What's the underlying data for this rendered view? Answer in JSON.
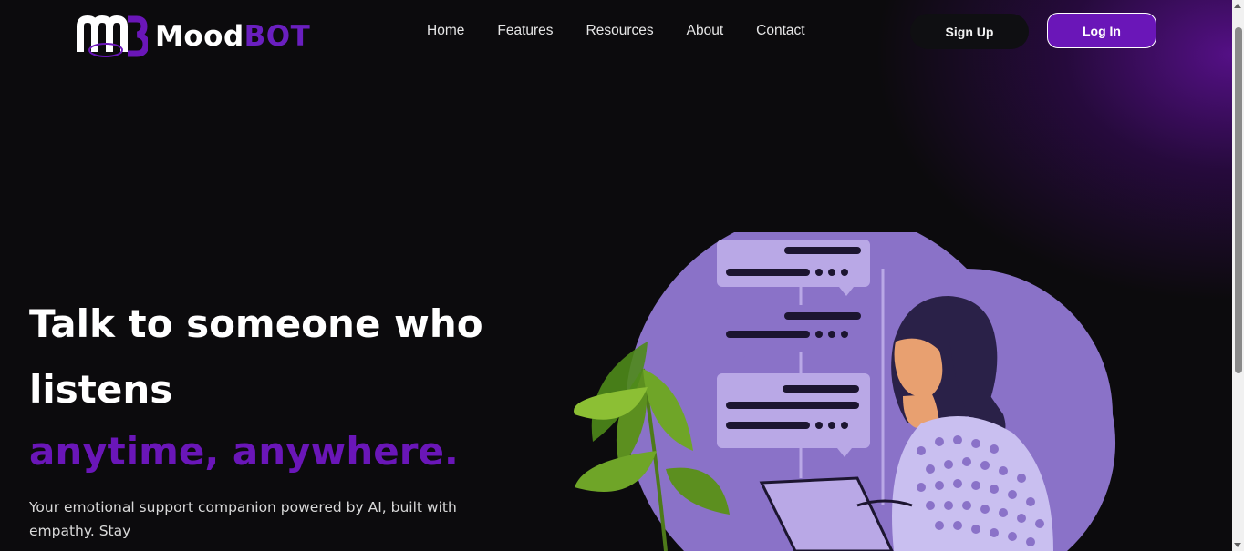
{
  "brand": {
    "name_part1": "Mood",
    "name_part2": "BOT",
    "logo_mark": "mb-monogram"
  },
  "nav": {
    "items": [
      "Home",
      "Features",
      "Resources",
      "About",
      "Contact"
    ]
  },
  "auth": {
    "signup_label": "Sign Up",
    "login_label": "Log In"
  },
  "hero": {
    "title_line1": "Talk to someone who listens",
    "title_accent": "anytime, anywhere.",
    "description": "Your emotional support companion powered by AI, built with empathy. Stay"
  },
  "colors": {
    "accent": "#6a16b8",
    "background": "#0c0b0d",
    "illustration_purple": "#8a72c8"
  }
}
